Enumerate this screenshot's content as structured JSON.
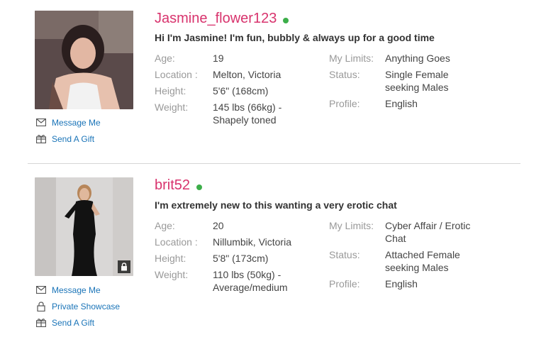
{
  "profiles": [
    {
      "username": "Jasmine_flower123",
      "tagline": "Hi I'm Jasmine! I'm fun, bubbly & always up for a good time",
      "left": [
        {
          "label": "Age:",
          "value": "19"
        },
        {
          "label": "Location :",
          "value": "Melton, Victoria"
        },
        {
          "label": "Height:",
          "value": "5'6\" (168cm)"
        },
        {
          "label": "Weight:",
          "value": "145 lbs (66kg) - Shapely toned"
        }
      ],
      "right": [
        {
          "label": "My Limits:",
          "value": "Anything Goes"
        },
        {
          "label": "Status:",
          "value": "Single Female seeking Males"
        },
        {
          "label": "Profile:",
          "value": "English"
        }
      ],
      "actions": [
        {
          "label": "Message Me",
          "icon": "envelope-icon"
        },
        {
          "label": "Send A Gift",
          "icon": "gift-icon"
        }
      ]
    },
    {
      "username": "brit52",
      "tagline": "I'm extremely new to this wanting a very erotic chat",
      "left": [
        {
          "label": "Age:",
          "value": "20"
        },
        {
          "label": "Location :",
          "value": "Nillumbik, Victoria"
        },
        {
          "label": "Height:",
          "value": "5'8\" (173cm)"
        },
        {
          "label": "Weight:",
          "value": "110 lbs (50kg) - Average/medium"
        }
      ],
      "right": [
        {
          "label": "My Limits:",
          "value": "Cyber Affair / Erotic Chat"
        },
        {
          "label": "Status:",
          "value": "Attached Female seeking Males"
        },
        {
          "label": "Profile:",
          "value": "English"
        }
      ],
      "actions": [
        {
          "label": "Message Me",
          "icon": "envelope-icon"
        },
        {
          "label": "Private Showcase",
          "icon": "lock-icon"
        },
        {
          "label": "Send A Gift",
          "icon": "gift-icon"
        }
      ]
    }
  ],
  "colors": {
    "username": "#d8336d",
    "online": "#3cae49",
    "link": "#1a74b8",
    "label": "#999999"
  }
}
